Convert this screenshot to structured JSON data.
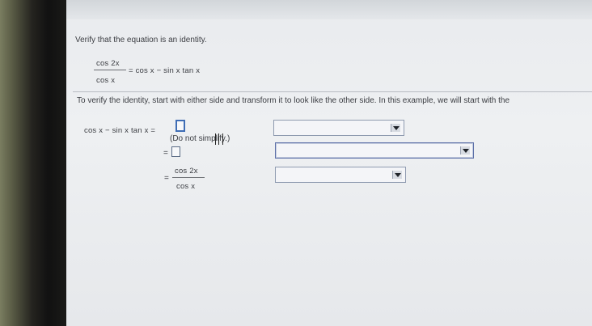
{
  "prompt": "Verify that the equation is an identity.",
  "equation": {
    "numerator": "cos 2x",
    "denominator": "cos x",
    "right_side": "= cos x − sin x tan x"
  },
  "instruction": "To verify the identity, start with either side and transform it to look like the other side. In this example, we will start with the",
  "steps": {
    "row1_left": "cos x − sin x tan x =",
    "hint": "(Do not simplify.)",
    "row2_prefix": "=",
    "row3_prefix": "=",
    "row3_numerator": "cos 2x",
    "row3_denominator": "cos x"
  },
  "dropdowns": [
    {
      "value": ""
    },
    {
      "value": ""
    },
    {
      "value": ""
    }
  ]
}
